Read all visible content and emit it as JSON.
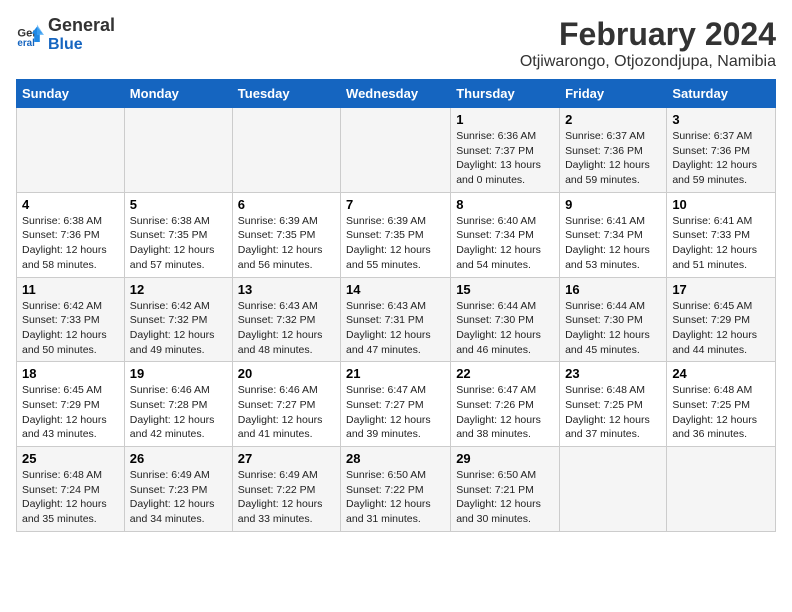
{
  "logo": {
    "line1": "General",
    "line2": "Blue"
  },
  "title": "February 2024",
  "subtitle": "Otjiwarongo, Otjozondjupa, Namibia",
  "weekdays": [
    "Sunday",
    "Monday",
    "Tuesday",
    "Wednesday",
    "Thursday",
    "Friday",
    "Saturday"
  ],
  "weeks": [
    [
      {
        "day": "",
        "info": ""
      },
      {
        "day": "",
        "info": ""
      },
      {
        "day": "",
        "info": ""
      },
      {
        "day": "",
        "info": ""
      },
      {
        "day": "1",
        "info": "Sunrise: 6:36 AM\nSunset: 7:37 PM\nDaylight: 13 hours\nand 0 minutes."
      },
      {
        "day": "2",
        "info": "Sunrise: 6:37 AM\nSunset: 7:36 PM\nDaylight: 12 hours\nand 59 minutes."
      },
      {
        "day": "3",
        "info": "Sunrise: 6:37 AM\nSunset: 7:36 PM\nDaylight: 12 hours\nand 59 minutes."
      }
    ],
    [
      {
        "day": "4",
        "info": "Sunrise: 6:38 AM\nSunset: 7:36 PM\nDaylight: 12 hours\nand 58 minutes."
      },
      {
        "day": "5",
        "info": "Sunrise: 6:38 AM\nSunset: 7:35 PM\nDaylight: 12 hours\nand 57 minutes."
      },
      {
        "day": "6",
        "info": "Sunrise: 6:39 AM\nSunset: 7:35 PM\nDaylight: 12 hours\nand 56 minutes."
      },
      {
        "day": "7",
        "info": "Sunrise: 6:39 AM\nSunset: 7:35 PM\nDaylight: 12 hours\nand 55 minutes."
      },
      {
        "day": "8",
        "info": "Sunrise: 6:40 AM\nSunset: 7:34 PM\nDaylight: 12 hours\nand 54 minutes."
      },
      {
        "day": "9",
        "info": "Sunrise: 6:41 AM\nSunset: 7:34 PM\nDaylight: 12 hours\nand 53 minutes."
      },
      {
        "day": "10",
        "info": "Sunrise: 6:41 AM\nSunset: 7:33 PM\nDaylight: 12 hours\nand 51 minutes."
      }
    ],
    [
      {
        "day": "11",
        "info": "Sunrise: 6:42 AM\nSunset: 7:33 PM\nDaylight: 12 hours\nand 50 minutes."
      },
      {
        "day": "12",
        "info": "Sunrise: 6:42 AM\nSunset: 7:32 PM\nDaylight: 12 hours\nand 49 minutes."
      },
      {
        "day": "13",
        "info": "Sunrise: 6:43 AM\nSunset: 7:32 PM\nDaylight: 12 hours\nand 48 minutes."
      },
      {
        "day": "14",
        "info": "Sunrise: 6:43 AM\nSunset: 7:31 PM\nDaylight: 12 hours\nand 47 minutes."
      },
      {
        "day": "15",
        "info": "Sunrise: 6:44 AM\nSunset: 7:30 PM\nDaylight: 12 hours\nand 46 minutes."
      },
      {
        "day": "16",
        "info": "Sunrise: 6:44 AM\nSunset: 7:30 PM\nDaylight: 12 hours\nand 45 minutes."
      },
      {
        "day": "17",
        "info": "Sunrise: 6:45 AM\nSunset: 7:29 PM\nDaylight: 12 hours\nand 44 minutes."
      }
    ],
    [
      {
        "day": "18",
        "info": "Sunrise: 6:45 AM\nSunset: 7:29 PM\nDaylight: 12 hours\nand 43 minutes."
      },
      {
        "day": "19",
        "info": "Sunrise: 6:46 AM\nSunset: 7:28 PM\nDaylight: 12 hours\nand 42 minutes."
      },
      {
        "day": "20",
        "info": "Sunrise: 6:46 AM\nSunset: 7:27 PM\nDaylight: 12 hours\nand 41 minutes."
      },
      {
        "day": "21",
        "info": "Sunrise: 6:47 AM\nSunset: 7:27 PM\nDaylight: 12 hours\nand 39 minutes."
      },
      {
        "day": "22",
        "info": "Sunrise: 6:47 AM\nSunset: 7:26 PM\nDaylight: 12 hours\nand 38 minutes."
      },
      {
        "day": "23",
        "info": "Sunrise: 6:48 AM\nSunset: 7:25 PM\nDaylight: 12 hours\nand 37 minutes."
      },
      {
        "day": "24",
        "info": "Sunrise: 6:48 AM\nSunset: 7:25 PM\nDaylight: 12 hours\nand 36 minutes."
      }
    ],
    [
      {
        "day": "25",
        "info": "Sunrise: 6:48 AM\nSunset: 7:24 PM\nDaylight: 12 hours\nand 35 minutes."
      },
      {
        "day": "26",
        "info": "Sunrise: 6:49 AM\nSunset: 7:23 PM\nDaylight: 12 hours\nand 34 minutes."
      },
      {
        "day": "27",
        "info": "Sunrise: 6:49 AM\nSunset: 7:22 PM\nDaylight: 12 hours\nand 33 minutes."
      },
      {
        "day": "28",
        "info": "Sunrise: 6:50 AM\nSunset: 7:22 PM\nDaylight: 12 hours\nand 31 minutes."
      },
      {
        "day": "29",
        "info": "Sunrise: 6:50 AM\nSunset: 7:21 PM\nDaylight: 12 hours\nand 30 minutes."
      },
      {
        "day": "",
        "info": ""
      },
      {
        "day": "",
        "info": ""
      }
    ]
  ]
}
